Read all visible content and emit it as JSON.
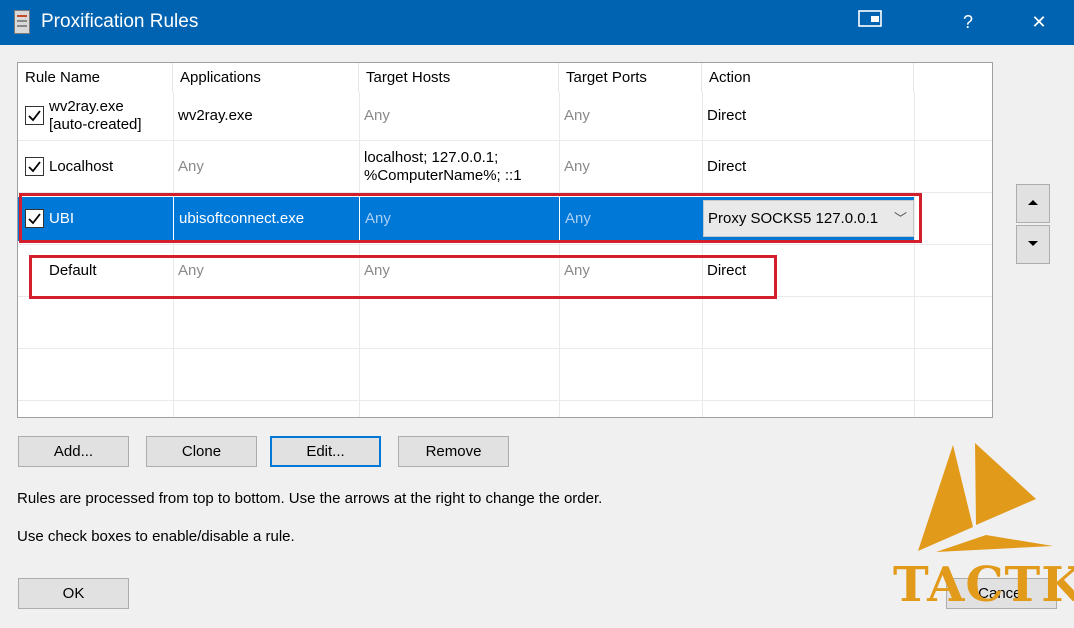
{
  "window": {
    "title": "Proxification Rules",
    "help_label": "?",
    "close_label": "✕"
  },
  "table": {
    "columns": [
      "Rule Name",
      "Applications",
      "Target Hosts",
      "Target Ports",
      "Action"
    ],
    "rows": [
      {
        "checked": true,
        "name": "wv2ray.exe\n[auto-created]",
        "applications": "wv2ray.exe",
        "target_hosts": "Any",
        "target_ports": "Any",
        "action": "Direct",
        "selected": false
      },
      {
        "checked": true,
        "name": "Localhost",
        "applications": "Any",
        "target_hosts": "localhost; 127.0.0.1;\n%ComputerName%; ::1",
        "target_ports": "Any",
        "action": "Direct",
        "selected": false
      },
      {
        "checked": true,
        "name": "UBI",
        "applications": "ubisoftconnect.exe",
        "target_hosts": "Any",
        "target_ports": "Any",
        "action": "Proxy SOCKS5 127.0.0.1",
        "selected": true
      },
      {
        "checked": false,
        "name": "Default",
        "applications": "Any",
        "target_hosts": "Any",
        "target_ports": "Any",
        "action": "Direct",
        "selected": false
      }
    ]
  },
  "buttons": {
    "add": "Add...",
    "clone": "Clone",
    "edit": "Edit...",
    "remove": "Remove",
    "ok": "OK",
    "cancel": "Cancel"
  },
  "info": {
    "line1": "Rules are processed from top to bottom. Use the arrows at the right to change the order.",
    "line2": "Use check boxes to enable/disable a rule."
  },
  "watermark": {
    "text": "TACTK",
    "color": "#e29a1a"
  },
  "colors": {
    "accent": "#0078d7",
    "titlebar": "#0063b1",
    "highlight": "#d11f2d"
  }
}
